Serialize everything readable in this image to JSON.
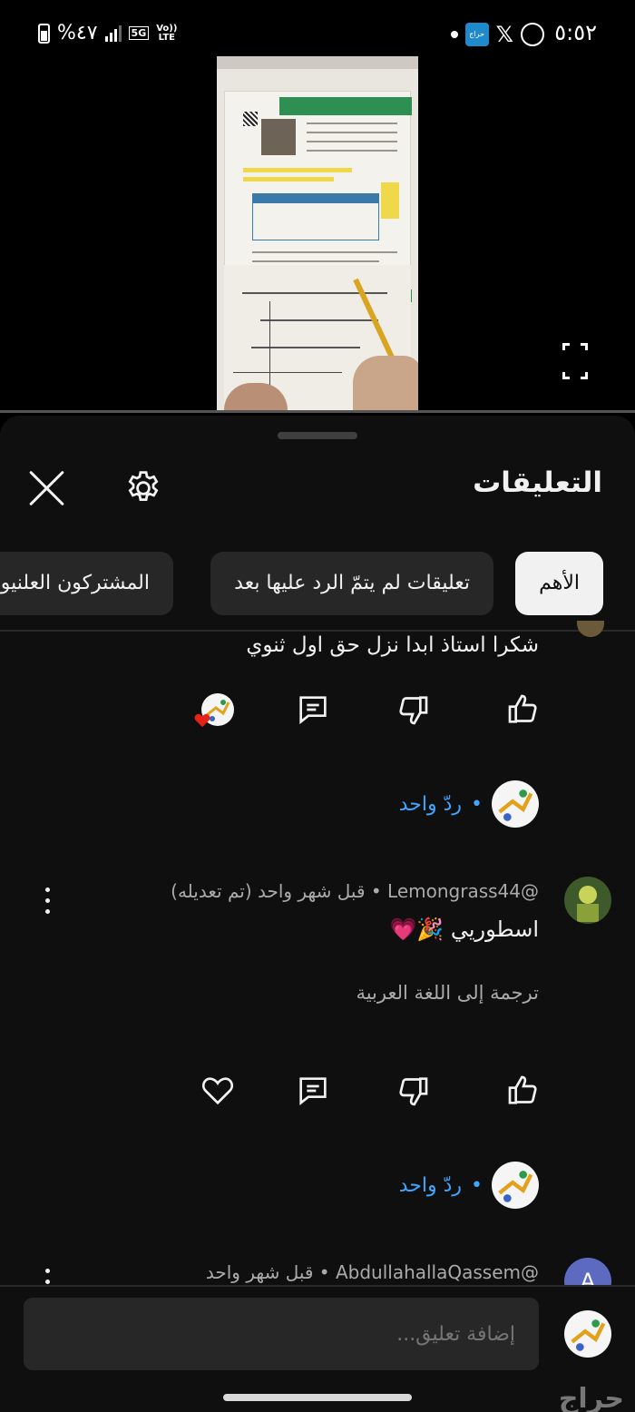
{
  "status_bar": {
    "time": "٥:٥٢",
    "battery_text": "%٤٧",
    "network_5g": "5G",
    "network_lte_top": "Vo))",
    "network_lte_bottom": "LTE",
    "app_badge": "حراج"
  },
  "comments": {
    "title": "التعليقات",
    "chips": [
      {
        "label": "الأهم",
        "active": true
      },
      {
        "label": "تعليقات لم يتمّ الرد عليها بعد",
        "active": false
      },
      {
        "label": "المشتركون العلنيون",
        "active": false
      }
    ],
    "items": [
      {
        "text": "شكرا استاذ ابدا نزل حق اول ثنوي",
        "reply_label": "ردّ واحد"
      },
      {
        "author": "@Lemongrass44",
        "time": "قبل شهر واحد (تم تعديله)",
        "text": "اسطوريي 🎉💗",
        "translate": "ترجمة إلى اللغة العربية",
        "reply_label": "ردّ واحد"
      },
      {
        "author": "@AbdullahallaQassem",
        "time": "قبل شهر واحد",
        "avatar_letter": "A"
      }
    ],
    "add_placeholder": "إضافة تعليق...",
    "colors": {
      "background": "#0f0f0f",
      "chip": "#272727",
      "link": "#3ea6ff",
      "avatar_a": "#5c6bc0"
    }
  },
  "watermark": "حراج"
}
